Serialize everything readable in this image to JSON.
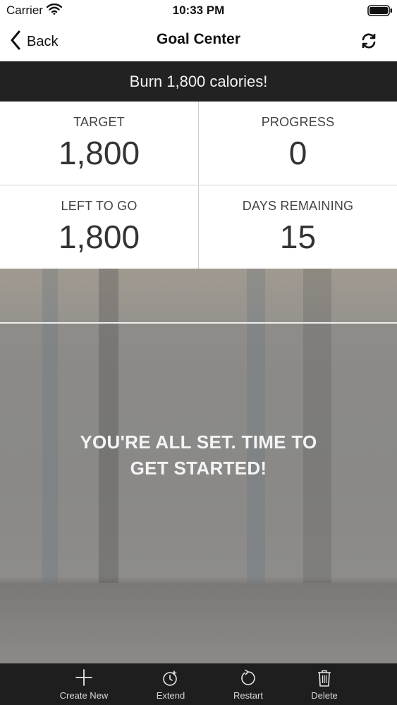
{
  "status_bar": {
    "carrier": "Carrier",
    "time": "10:33 PM"
  },
  "nav": {
    "back_label": "Back",
    "title": "Goal Center"
  },
  "goal": {
    "banner": "Burn 1,800 calories!"
  },
  "stats": [
    {
      "label": "TARGET",
      "value": "1,800"
    },
    {
      "label": "PROGRESS",
      "value": "0"
    },
    {
      "label": "LEFT TO GO",
      "value": "1,800"
    },
    {
      "label": "DAYS REMAINING",
      "value": "15"
    }
  ],
  "hero": {
    "message_line1": "YOU'RE ALL SET. TIME TO",
    "message_line2": "GET STARTED!"
  },
  "toolbar": {
    "create_new": "Create New",
    "extend": "Extend",
    "restart": "Restart",
    "delete": "Delete"
  },
  "icons": {
    "wifi": "wifi-icon",
    "battery": "battery-icon",
    "back": "chevron-left-icon",
    "refresh": "refresh-icon",
    "create_new": "plus-icon",
    "extend": "alarm-clock-icon",
    "restart": "restart-icon",
    "delete": "trash-icon"
  }
}
